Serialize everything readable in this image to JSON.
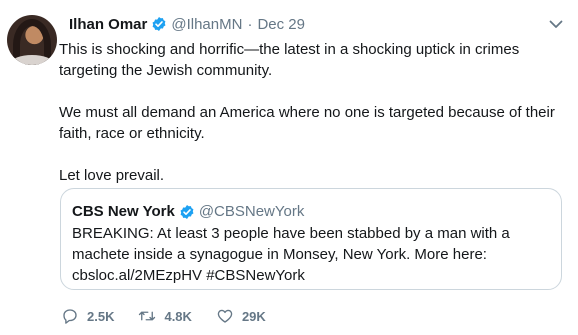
{
  "tweet": {
    "author_name": "Ilhan Omar",
    "author_handle": "@IlhanMN",
    "separator": "·",
    "date": "Dec 29",
    "paragraphs": [
      "This is shocking and horrific—the latest in a shocking uptick in crimes targeting the Jewish community.",
      "We must all demand an America where no one is targeted because of their faith, race or ethnicity.",
      "Let love prevail."
    ]
  },
  "quoted_tweet": {
    "author_name": "CBS New York",
    "author_handle": "@CBSNewYork",
    "text": "BREAKING: At least 3 people have been stabbed by a man with a machete inside a synagogue in Monsey, New York. More here: cbsloc.al/2MEzpHV #CBSNewYork"
  },
  "actions": {
    "replies": "2.5K",
    "retweets": "4.8K",
    "likes": "29K"
  },
  "icons": [
    "verified-badge-icon",
    "chevron-down-icon",
    "reply-icon",
    "retweet-icon",
    "like-icon"
  ],
  "colors": {
    "verified": "#1da1f2",
    "text_primary": "#14171a",
    "text_secondary": "#657786",
    "border": "#ccd6dd"
  }
}
